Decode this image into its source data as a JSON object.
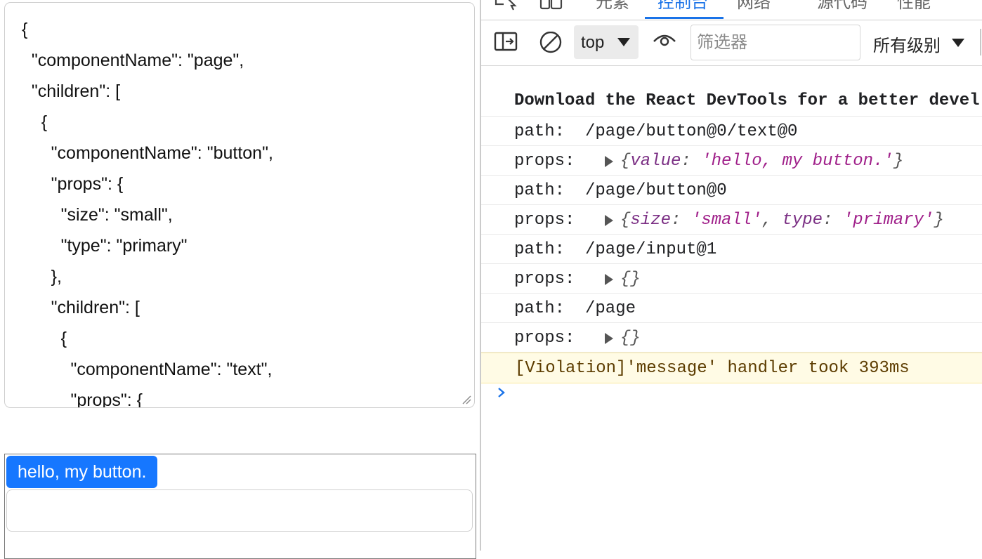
{
  "editor": {
    "lines": [
      "{",
      "  \"componentName\": \"page\",",
      "  \"children\": [",
      "    {",
      "      \"componentName\": \"button\",",
      "      \"props\": {",
      "        \"size\": \"small\",",
      "        \"type\": \"primary\"",
      "      },",
      "      \"children\": [",
      "        {",
      "          \"componentName\": \"text\",",
      "          \"props\": {"
    ]
  },
  "preview": {
    "button_label": "hello, my button.",
    "input_value": ""
  },
  "devtools": {
    "tabs": [
      "元素",
      "控制台",
      "网络",
      "源代码",
      "性能"
    ],
    "active_tab": "控制台",
    "accent_color": "#1a73e8",
    "toolbar": {
      "context": "top",
      "filter_placeholder": "筛选器",
      "levels_label": "所有级别"
    },
    "console": {
      "banner": "Download the React DevTools for a better devel",
      "entries": [
        {
          "path_key": "path:",
          "path": "/page/button@0/text@0",
          "props_key": "props:",
          "props": [
            [
              "value",
              "'hello, my button.'"
            ]
          ]
        },
        {
          "path_key": "path:",
          "path": "/page/button@0",
          "props_key": "props:",
          "props": [
            [
              "size",
              "'small'"
            ],
            [
              "type",
              "'primary'"
            ]
          ]
        },
        {
          "path_key": "path:",
          "path": "/page/input@1",
          "props_key": "props:",
          "props": []
        },
        {
          "path_key": "path:",
          "path": "/page",
          "props_key": "props:",
          "props": []
        }
      ],
      "violation": "[Violation]'message' handler took 393ms"
    }
  }
}
